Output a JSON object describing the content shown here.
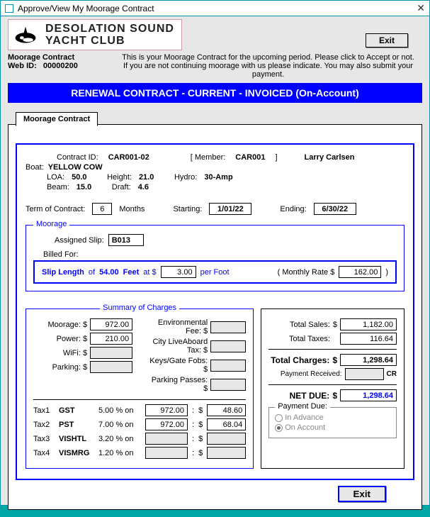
{
  "window_title": "Approve/View My Moorage Contract",
  "club_name_line1": "DESOLATION SOUND",
  "club_name_line2": "YACHT CLUB",
  "exit_label": "Exit",
  "subheader": {
    "title": "Moorage Contract",
    "webid_label": "Web ID:",
    "webid": "00000200",
    "notice_line1": "This is your Moorage Contract for the upcoming period.  Please click to Accept or not.",
    "notice_line2": "If you are not continuing moorage with us please indicate.  You may also submit your payment."
  },
  "banner": "RENEWAL CONTRACT - CURRENT - INVOICED (On-Account)",
  "tab_label": "Moorage Contract",
  "contract": {
    "contract_id_label": "Contract ID:",
    "contract_id": "CAR001-02",
    "member_label": "[ Member:",
    "member_id": "CAR001",
    "member_close": "]",
    "member_name": "Larry Carlsen",
    "boat_label": "Boat:",
    "boat_name": "YELLOW COW",
    "loa_label": "LOA:",
    "loa": "50.0",
    "height_label": "Height:",
    "height": "21.0",
    "hydro_label": "Hydro:",
    "hydro": "30-Amp",
    "beam_label": "Beam:",
    "beam": "15.0",
    "draft_label": "Draft:",
    "draft": "4.6"
  },
  "term": {
    "term_label": "Term of Contract:",
    "months": "6",
    "months_label": "Months",
    "starting_label": "Starting:",
    "start_date": "1/01/22",
    "ending_label": "Ending:",
    "end_date": "6/30/22"
  },
  "moorage": {
    "legend": "Moorage",
    "assigned_label": "Assigned Slip:",
    "assigned_slip": "B013",
    "billed_for_label": "Billed For:",
    "slip_length_label": "Slip Length",
    "of": "of",
    "slip_length": "54.00",
    "feet": "Feet",
    "at": "at $",
    "rate": "3.00",
    "per_foot": "per Foot",
    "monthly_label": "( Monthly Rate $",
    "monthly_rate": "162.00",
    "monthly_close": ")"
  },
  "charges": {
    "legend": "Summary of Charges",
    "moorage_label": "Moorage: $",
    "moorage": "972.00",
    "power_label": "Power: $",
    "power": "210.00",
    "wifi_label": "WiFi: $",
    "wifi": "",
    "parking_label": "Parking: $",
    "parking": "",
    "env_label": "Environmental Fee: $",
    "env": "",
    "la_tax_label": "City LiveAboard Tax: $",
    "la_tax": "",
    "keys_label": "Keys/Gate Fobs: $",
    "keys": "",
    "passes_label": "Parking Passes: $",
    "passes": ""
  },
  "taxes": [
    {
      "idx": "Tax1",
      "name": "GST",
      "pct": "5.00 % on",
      "base": "972.00",
      "amt": "48.60"
    },
    {
      "idx": "Tax2",
      "name": "PST",
      "pct": "7.00 % on",
      "base": "972.00",
      "amt": "68.04"
    },
    {
      "idx": "Tax3",
      "name": "VISHTL",
      "pct": "3.20 % on",
      "base": "",
      "amt": ""
    },
    {
      "idx": "Tax4",
      "name": "VISMRG",
      "pct": "1.20 % on",
      "base": "",
      "amt": ""
    }
  ],
  "totals": {
    "total_sales_label": "Total Sales:",
    "total_sales": "1,182.00",
    "total_taxes_label": "Total Taxes:",
    "total_taxes": "116.64",
    "total_charges_label": "Total Charges:",
    "total_charges": "1,298.64",
    "payment_rcvd_label": "Payment Received:",
    "payment_rcvd": "",
    "cr_label": "CR",
    "net_due_label": "NET DUE:",
    "net_due": "1,298.64",
    "dollar": "$"
  },
  "payment_due": {
    "legend": "Payment Due:",
    "in_advance": "In Advance",
    "on_account": "On Account"
  }
}
